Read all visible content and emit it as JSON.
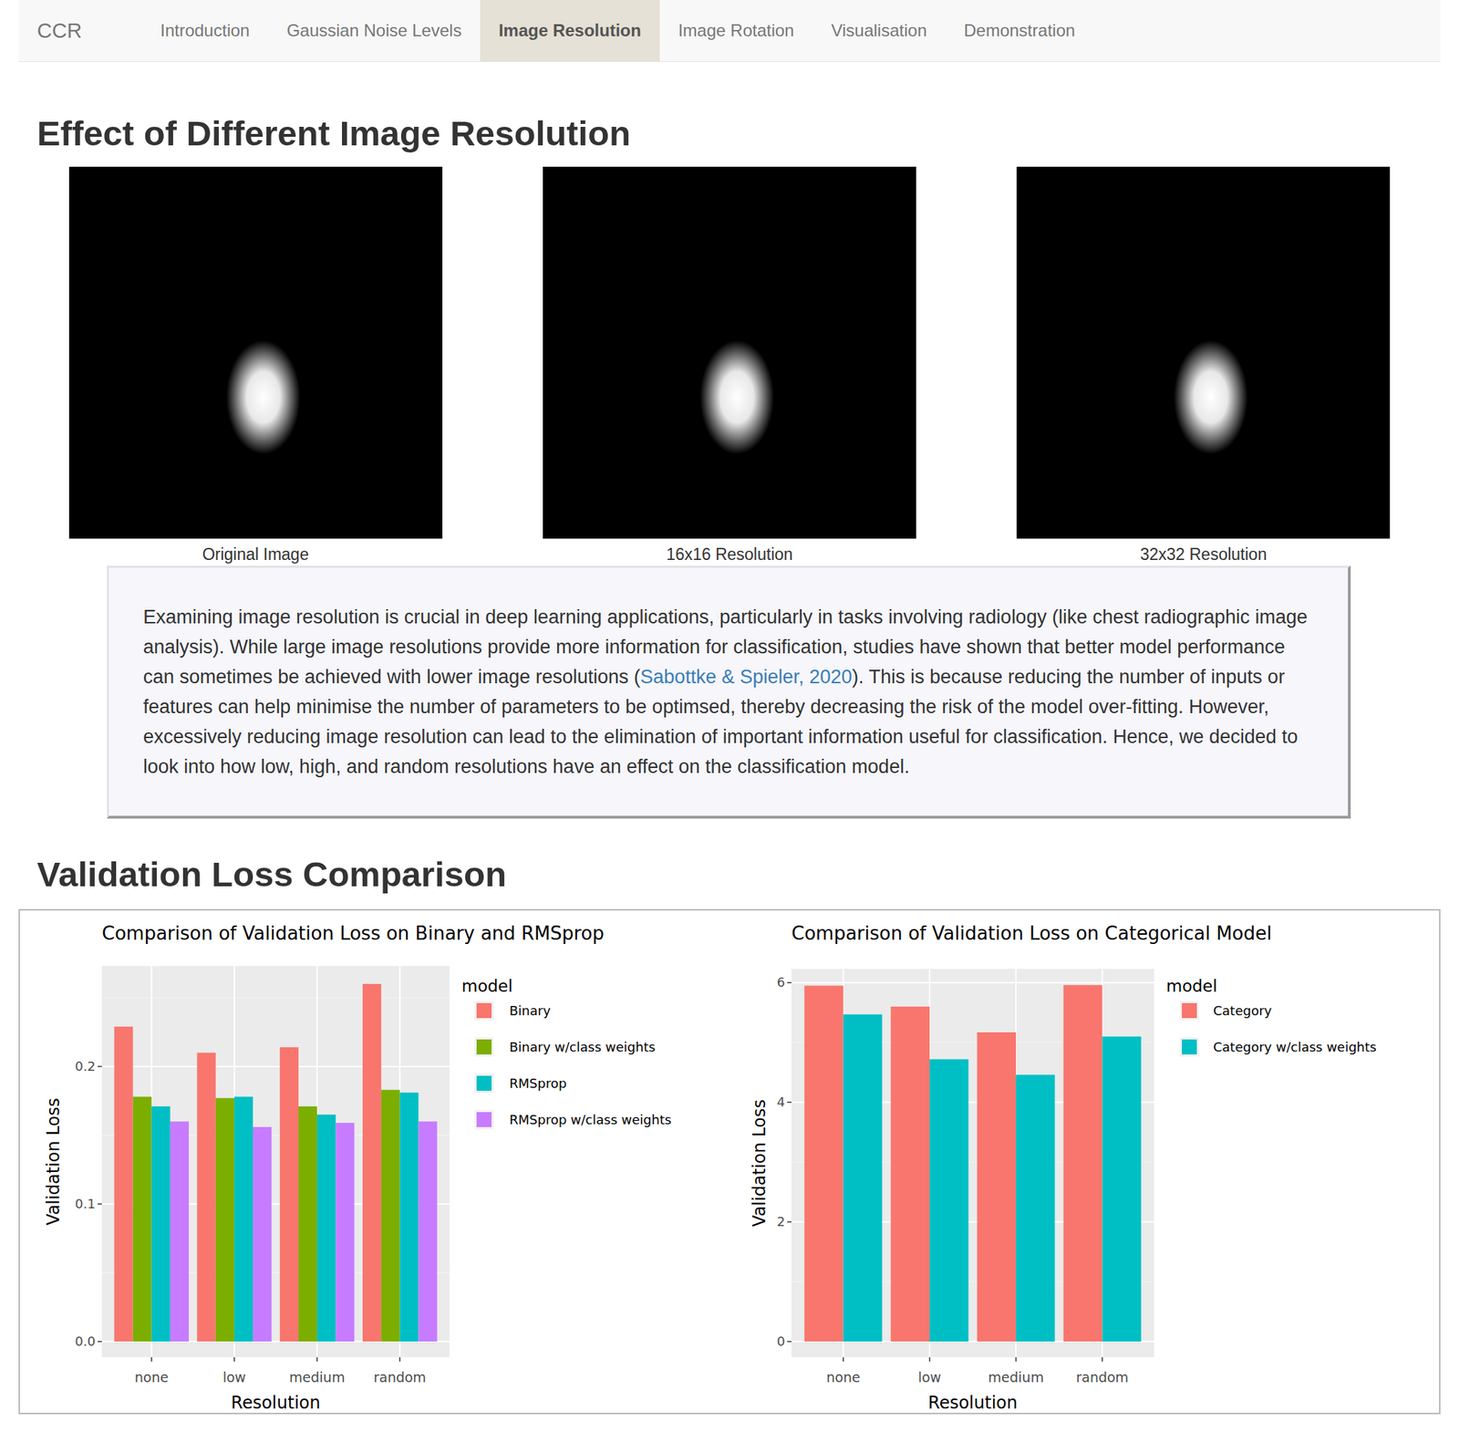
{
  "nav": {
    "brand": "CCR",
    "tabs": [
      {
        "label": "Introduction",
        "selected": false
      },
      {
        "label": "Gaussian Noise Levels",
        "selected": false
      },
      {
        "label": "Image Resolution",
        "selected": true
      },
      {
        "label": "Image Rotation",
        "selected": false
      },
      {
        "label": "Visualisation",
        "selected": false
      },
      {
        "label": "Demonstration",
        "selected": false
      }
    ]
  },
  "section_title": "Effect of Different Image Resolution",
  "images": [
    {
      "caption": "Original Image"
    },
    {
      "caption": "16x16 Resolution"
    },
    {
      "caption": "32x32 Resolution"
    }
  ],
  "paragraph": {
    "before": "Examining image resolution is crucial in deep learning applications, particularly in tasks involving radiology (like chest radiographic image analysis). While large image resolutions provide more information for classification, studies have shown that better model performance can sometimes be achieved with lower image resolutions (",
    "link": "Sabottke & Spieler, 2020",
    "after": "). This is because reducing the number of inputs or features can help minimise the number of parameters to be optimsed, thereby decreasing the risk of the model over-fitting. However, excessively reducing image resolution can lead to the elimination of important information useful for classification. Hence, we decided to look into how low, high, and random resolutions have an effect on the classification model."
  },
  "comparison_title": "Validation Loss Comparison",
  "charts": [
    {
      "title": "Comparison of Validation Loss on Binary and RMSprop",
      "x_axis_title": "Resolution",
      "y_axis_title": "Validation Loss",
      "categories": [
        "none",
        "low",
        "medium",
        "random"
      ],
      "y_ticks": [
        "0.0",
        "0.1",
        "0.2"
      ],
      "legend_title": "model",
      "series": [
        {
          "name": "Binary",
          "color": "#F8766D",
          "values": [
            0.229,
            0.21,
            0.214,
            0.26
          ]
        },
        {
          "name": "Binary w/class weights",
          "color": "#7CAE00",
          "values": [
            0.178,
            0.177,
            0.171,
            0.183
          ]
        },
        {
          "name": "RMSprop",
          "color": "#00BFC4",
          "values": [
            0.171,
            0.178,
            0.165,
            0.181
          ]
        },
        {
          "name": "RMSprop w/class weights",
          "color": "#C77CFF",
          "values": [
            0.16,
            0.156,
            0.159,
            0.16
          ]
        }
      ]
    },
    {
      "title": "Comparison of Validation Loss on Categorical Model",
      "x_axis_title": "Resolution",
      "y_axis_title": "Validation Loss",
      "categories": [
        "none",
        "low",
        "medium",
        "random"
      ],
      "y_ticks": [
        "0",
        "2",
        "4",
        "6"
      ],
      "legend_title": "model",
      "series": [
        {
          "name": "Category",
          "color": "#F8766D",
          "values": [
            5.95,
            5.6,
            5.17,
            5.96
          ]
        },
        {
          "name": "Category w/class weights",
          "color": "#00BFC4",
          "values": [
            5.47,
            4.72,
            4.46,
            5.1
          ]
        }
      ]
    }
  ]
}
